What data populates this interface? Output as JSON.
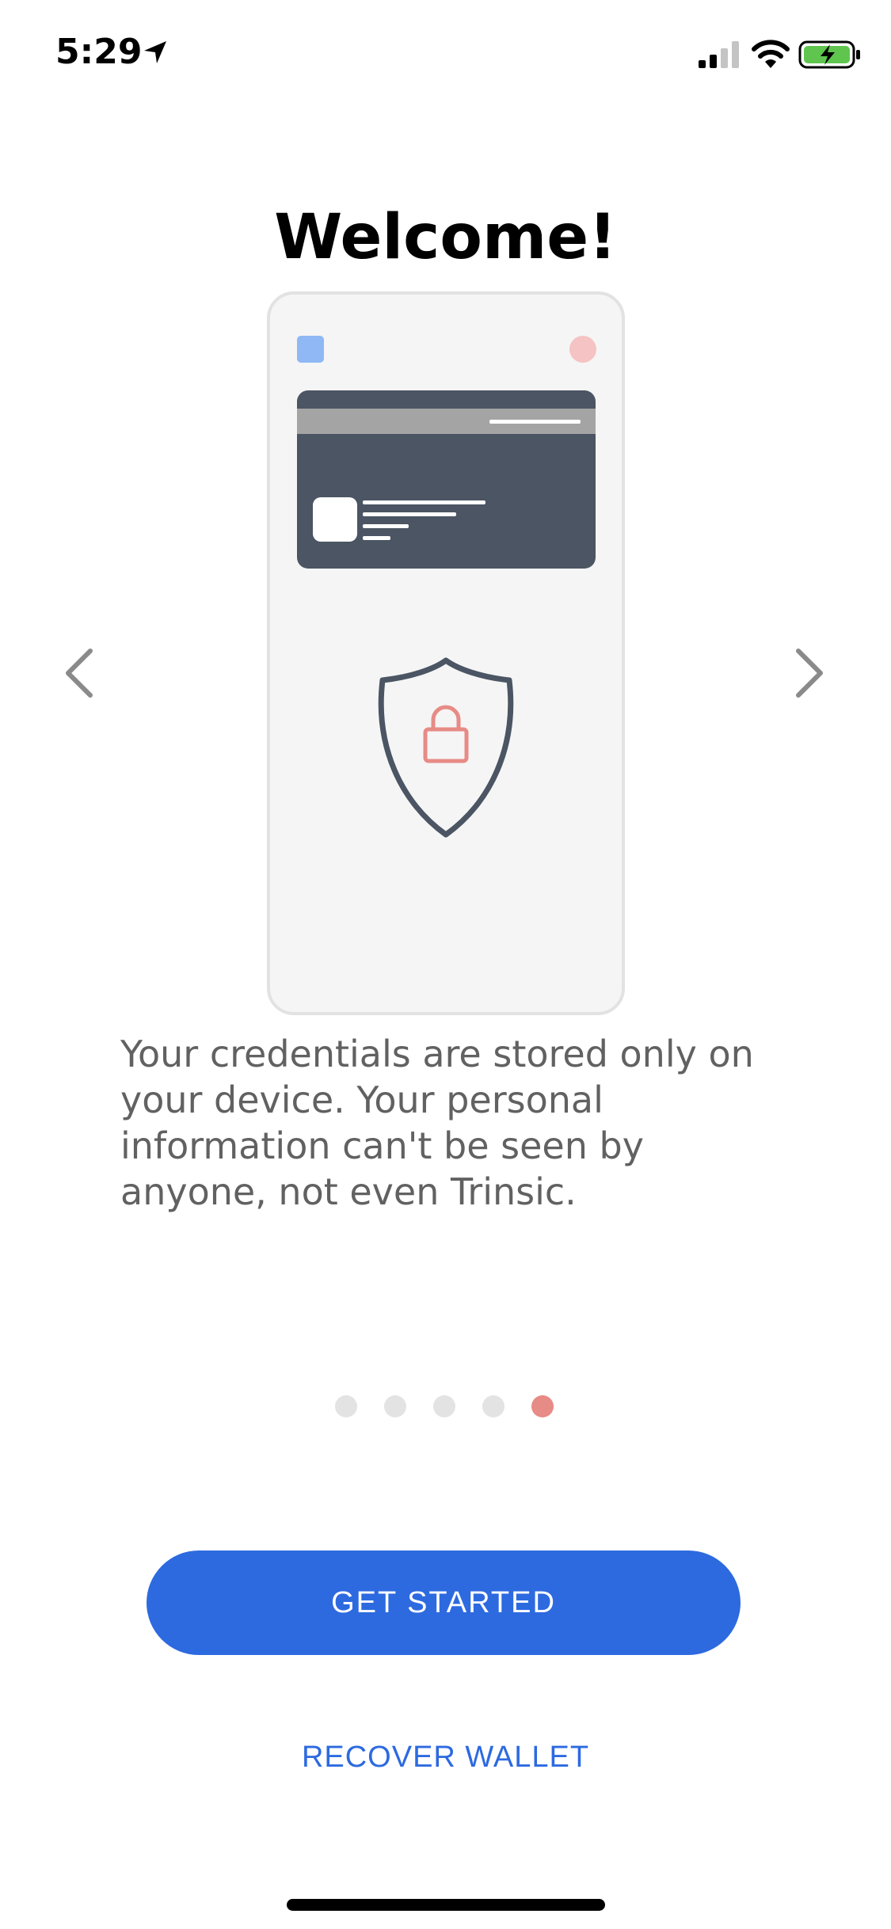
{
  "status_bar": {
    "time": "5:29",
    "icons": [
      "location-arrow-icon",
      "cellular-signal-icon",
      "wifi-icon",
      "battery-charging-icon"
    ],
    "battery_color": "#5fc54f"
  },
  "onboarding": {
    "title": "Welcome!",
    "description": "Your credentials are stored only on your device. Your personal information can't be seen by anyone, not even Trinsic.",
    "illustration_icons": [
      "phone-frame",
      "credential-card",
      "shield-lock-icon"
    ],
    "page_count": 5,
    "current_page": 5,
    "nav": {
      "prev_icon": "chevron-left-icon",
      "next_icon": "chevron-right-icon"
    }
  },
  "actions": {
    "get_started_label": "GET STARTED",
    "recover_wallet_label": "RECOVER WALLET"
  },
  "colors": {
    "primary": "#2d6ae0",
    "accent": "#e78b86",
    "card": "#4b5563",
    "text_secondary": "#616161"
  }
}
